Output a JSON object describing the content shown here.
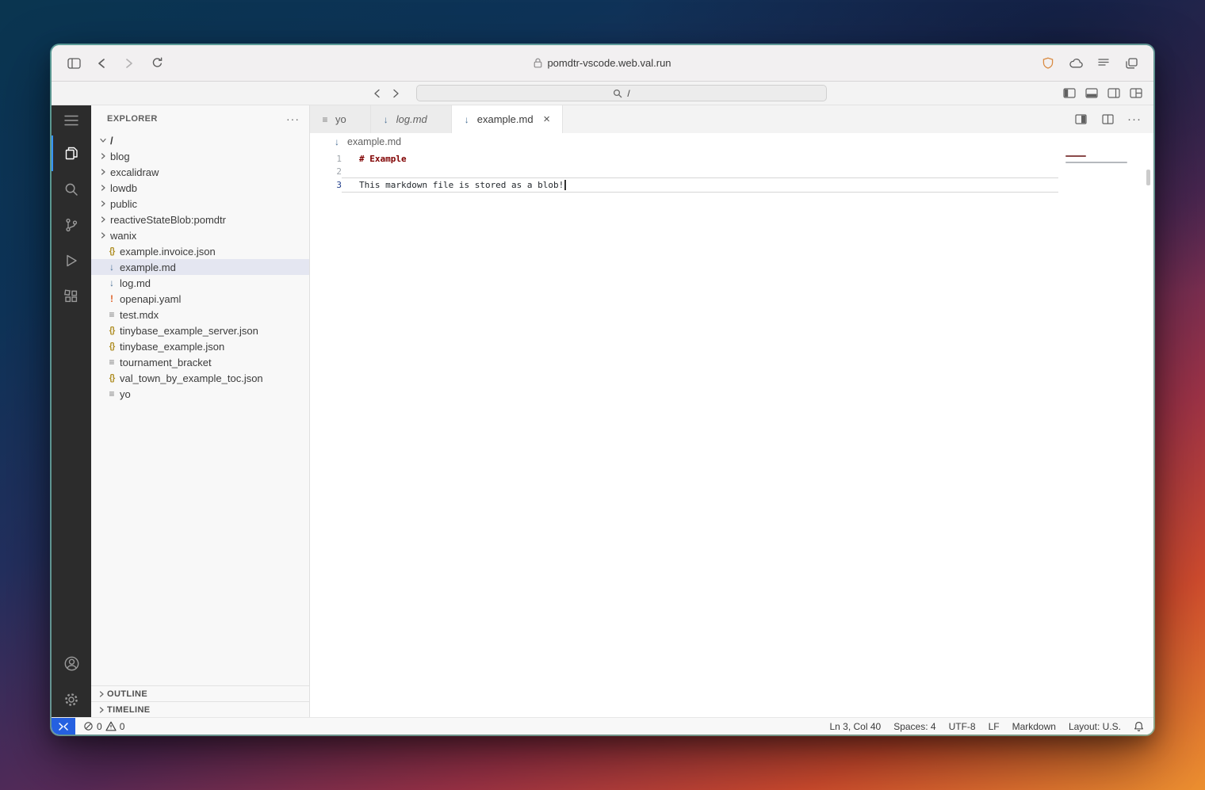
{
  "colors": {
    "remote_accent": "#2560e0",
    "selection_bg": "#e4e6f1",
    "heading_red": "#800000",
    "activity_bar_bg": "#2c2c2c",
    "active_indicator": "#3794ff"
  },
  "browser": {
    "url": "pomdtr-vscode.web.val.run"
  },
  "titlebar": {
    "command_center": "/"
  },
  "explorer": {
    "title": "EXPLORER",
    "actions": "···",
    "root": "/",
    "tree": [
      {
        "name": "blog",
        "type": "folder"
      },
      {
        "name": "excalidraw",
        "type": "folder"
      },
      {
        "name": "lowdb",
        "type": "folder"
      },
      {
        "name": "public",
        "type": "folder"
      },
      {
        "name": "reactiveStateBlob:pomdtr",
        "type": "folder"
      },
      {
        "name": "wanix",
        "type": "folder"
      },
      {
        "name": "example.invoice.json",
        "type": "json"
      },
      {
        "name": "example.md",
        "type": "markdown",
        "selected": true
      },
      {
        "name": "log.md",
        "type": "markdown"
      },
      {
        "name": "openapi.yaml",
        "type": "yaml"
      },
      {
        "name": "test.mdx",
        "type": "file"
      },
      {
        "name": "tinybase_example_server.json",
        "type": "json"
      },
      {
        "name": "tinybase_example.json",
        "type": "json"
      },
      {
        "name": "tournament_bracket",
        "type": "file"
      },
      {
        "name": "val_town_by_example_toc.json",
        "type": "json"
      },
      {
        "name": "yo",
        "type": "file"
      }
    ],
    "sections": [
      {
        "label": "OUTLINE"
      },
      {
        "label": "TIMELINE"
      }
    ]
  },
  "tabs": [
    {
      "label": "yo",
      "icon": "file-icon",
      "state": "inactive"
    },
    {
      "label": "log.md",
      "icon": "markdown-icon",
      "state": "preview"
    },
    {
      "label": "example.md",
      "icon": "markdown-icon",
      "state": "active"
    }
  ],
  "breadcrumb": {
    "file": "example.md"
  },
  "editor": {
    "lines": [
      {
        "num": "1",
        "text": "# Example"
      },
      {
        "num": "2",
        "text": ""
      },
      {
        "num": "3",
        "text": "This markdown file is stored as a blob!"
      }
    ]
  },
  "status_bar": {
    "errors": "0",
    "warnings": "0",
    "right": [
      "Ln 3, Col 40",
      "Spaces: 4",
      "UTF-8",
      "LF",
      "Markdown",
      "Layout: U.S."
    ]
  }
}
